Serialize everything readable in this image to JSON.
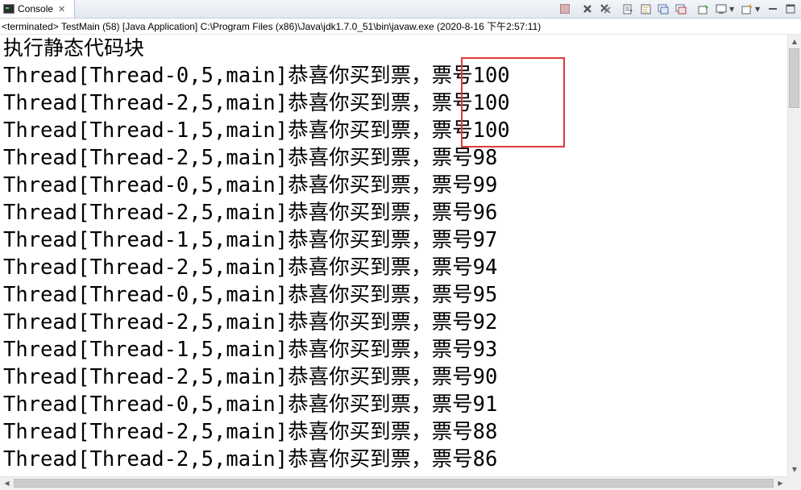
{
  "tab": {
    "label": "Console",
    "close_glyph": "✕",
    "icon": "console-icon"
  },
  "toolbar": {
    "icons": [
      "terminate-icon",
      "remove-launch-icon",
      "remove-all-terminated-icon",
      "scroll-lock-icon",
      "word-wrap-icon",
      "show-on-stdout-icon",
      "show-on-stderr-icon",
      "pin-console-icon",
      "display-console-icon",
      "open-console-icon"
    ],
    "colors": {
      "terminate": "#c8a8a8",
      "remove": "#555555"
    }
  },
  "status_line": "<terminated> TestMain (58) [Java Application] C:\\Program Files (x86)\\Java\\jdk1.7.0_51\\bin\\javaw.exe (2020-8-16 下午2:57:11)",
  "console": {
    "heading": "执行静态代码块",
    "lines": [
      "Thread[Thread-0,5,main]恭喜你买到票，票号100",
      "Thread[Thread-2,5,main]恭喜你买到票，票号100",
      "Thread[Thread-1,5,main]恭喜你买到票，票号100",
      "Thread[Thread-2,5,main]恭喜你买到票，票号98",
      "Thread[Thread-0,5,main]恭喜你买到票，票号99",
      "Thread[Thread-2,5,main]恭喜你买到票，票号96",
      "Thread[Thread-1,5,main]恭喜你买到票，票号97",
      "Thread[Thread-2,5,main]恭喜你买到票，票号94",
      "Thread[Thread-0,5,main]恭喜你买到票，票号95",
      "Thread[Thread-2,5,main]恭喜你买到票，票号92",
      "Thread[Thread-1,5,main]恭喜你买到票，票号93",
      "Thread[Thread-2,5,main]恭喜你买到票，票号90",
      "Thread[Thread-0,5,main]恭喜你买到票，票号91",
      "Thread[Thread-2,5,main]恭喜你买到票，票号88",
      "Thread[Thread-2,5,main]恭喜你买到票，票号86"
    ],
    "highlight_color": "#e03a3a"
  }
}
